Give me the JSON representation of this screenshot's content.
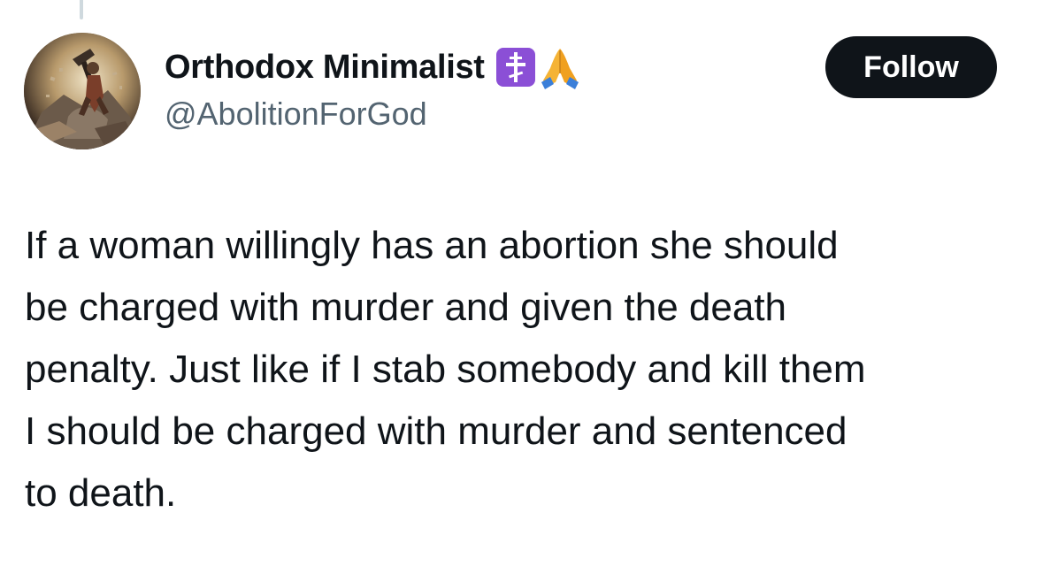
{
  "author": {
    "display_name": "Orthodox Minimalist",
    "handle": "@AbolitionForGod",
    "name_icons": [
      "orthodox-cross-icon",
      "folded-hands-icon"
    ]
  },
  "follow_label": "Follow",
  "tweet": {
    "text": "If a woman willingly has an abortion she should\nbe charged with murder and given the death\npenalty. Just like if I stab somebody and kill them\nI should be charged with murder and sentenced\nto death."
  },
  "colors": {
    "text_primary": "#0f1419",
    "text_secondary": "#536471",
    "follow_bg": "#0f1419",
    "follow_text": "#ffffff",
    "orthodox_badge_bg": "#8b4fd6"
  }
}
